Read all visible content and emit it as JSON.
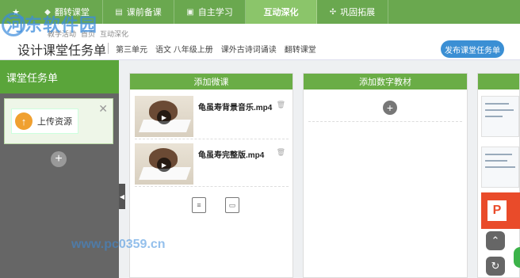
{
  "nav": {
    "tabs": [
      {
        "label": "翻转课堂",
        "icon": "flip-icon"
      },
      {
        "label": "课前备课",
        "icon": "book-icon"
      },
      {
        "label": "自主学习",
        "icon": "study-icon"
      },
      {
        "label": "互动深化",
        "icon": "interact-icon",
        "active": true
      },
      {
        "label": "巩固拓展",
        "icon": "extend-icon"
      }
    ]
  },
  "header": {
    "breadcrumb": [
      "教学活动",
      "首页",
      "互动深化"
    ],
    "title": "设计课堂任务单",
    "meta": [
      "第三单元",
      "语文 八年级上册",
      "课外古诗词诵读",
      "翻转课堂"
    ],
    "publish_label": "发布课堂任务单"
  },
  "watermark": {
    "line1": "河东软件园",
    "line2": "www.pc0359.cn"
  },
  "sidebar": {
    "title": "课堂任务单",
    "upload_label": "上传资源",
    "close_glyph": "✕",
    "add_glyph": "+"
  },
  "columns": {
    "micro_video": {
      "title": "添加微课",
      "items": [
        {
          "name": "龟虽寿背景音乐.mp4"
        },
        {
          "name": "龟虽寿完整版.mp4"
        }
      ]
    },
    "digital_material": {
      "title": "添加数字教材",
      "add_glyph": "+"
    }
  },
  "colors": {
    "nav_green": "#6aa84f",
    "accent_blue": "#3b8fd4",
    "header_green": "#6aad46"
  }
}
